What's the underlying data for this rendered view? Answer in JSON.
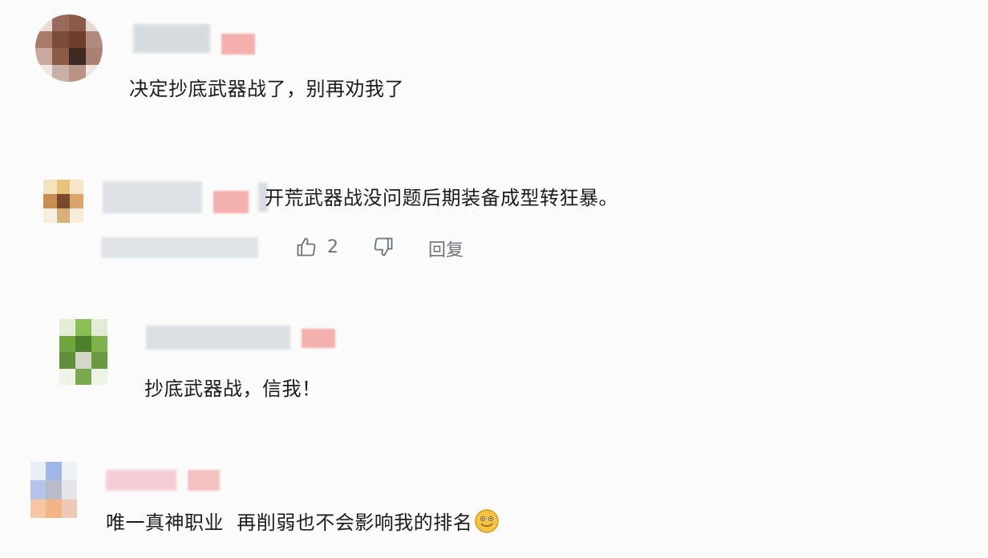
{
  "comments": [
    {
      "text": "决定抄底武器战了，别再劝我了"
    },
    {
      "text": "开荒武器战没问题后期装备成型转狂暴。"
    },
    {
      "text": "抄底武器战，信我！"
    },
    {
      "text": "唯一真神职业  再削弱也不会影响我的排名"
    }
  ],
  "actions": {
    "like_count": "2",
    "reply_label": "回复"
  },
  "icons": {
    "like": "thumbs-up-icon",
    "dislike": "thumbs-down-icon",
    "emoji": "smiley-emoji-icon"
  },
  "colors": {
    "background": "#fbfbfb",
    "tag": "#f3a3a0",
    "mosaic": "#d9dde1",
    "action_text": "#70757a"
  }
}
